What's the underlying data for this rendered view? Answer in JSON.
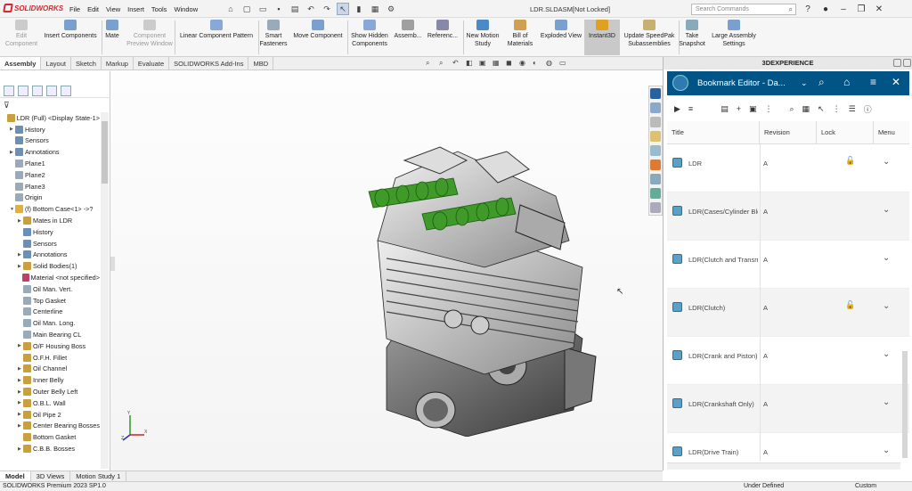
{
  "titlebar": {
    "menus": [
      "File",
      "Edit",
      "View",
      "Insert",
      "Tools",
      "Window"
    ],
    "document_title": "LDR.SLDASM[Not Locked]",
    "search_placeholder": "Search Commands",
    "brand": "SOLIDWORKS"
  },
  "ribbon": [
    {
      "label": "Edit\nComponent",
      "disabled": true
    },
    {
      "label": "Insert Components",
      "disabled": false
    },
    {
      "label": "Mate",
      "disabled": false
    },
    {
      "label": "Component\nPreview Window",
      "disabled": true
    },
    {
      "label": "Linear Component Pattern",
      "disabled": false
    },
    {
      "label": "Smart\nFasteners",
      "disabled": false
    },
    {
      "label": "Move Component",
      "disabled": false
    },
    {
      "label": "Show Hidden\nComponents",
      "disabled": false
    },
    {
      "label": "Assemb...",
      "disabled": false
    },
    {
      "label": "Referenc...",
      "disabled": false
    },
    {
      "label": "New Motion\nStudy",
      "disabled": false
    },
    {
      "label": "Bill of\nMaterials",
      "disabled": false
    },
    {
      "label": "Exploded View",
      "disabled": false
    },
    {
      "label": "Instant3D",
      "disabled": false,
      "active": true
    },
    {
      "label": "Update SpeedPak\nSubassemblies",
      "disabled": false
    },
    {
      "label": "Take\nSnapshot",
      "disabled": false
    },
    {
      "label": "Large Assembly\nSettings",
      "disabled": false
    }
  ],
  "command_tabs": [
    "Assembly",
    "Layout",
    "Sketch",
    "Markup",
    "Evaluate",
    "SOLIDWORKS Add-Ins",
    "MBD"
  ],
  "tree": [
    {
      "label": "LDR (Full) <Display State-1>",
      "indent": 0,
      "expand": "",
      "icon": "#c8a040"
    },
    {
      "label": "History",
      "indent": 1,
      "expand": "▶",
      "icon": "#6b8fb5"
    },
    {
      "label": "Sensors",
      "indent": 1,
      "expand": "",
      "icon": "#6b8fb5"
    },
    {
      "label": "Annotations",
      "indent": 1,
      "expand": "▶",
      "icon": "#6b8fb5"
    },
    {
      "label": "Plane1",
      "indent": 1,
      "expand": "",
      "icon": "#9ab"
    },
    {
      "label": "Plane2",
      "indent": 1,
      "expand": "",
      "icon": "#9ab"
    },
    {
      "label": "Plane3",
      "indent": 1,
      "expand": "",
      "icon": "#9ab"
    },
    {
      "label": "Origin",
      "indent": 1,
      "expand": "",
      "icon": "#9ab"
    },
    {
      "label": "(f) Bottom Case<1> ->?",
      "indent": 1,
      "expand": "▼",
      "icon": "#e0b040"
    },
    {
      "label": "Mates in LDR",
      "indent": 2,
      "expand": "▶",
      "icon": "#c8a040"
    },
    {
      "label": "History",
      "indent": 2,
      "expand": "",
      "icon": "#6b8fb5"
    },
    {
      "label": "Sensors",
      "indent": 2,
      "expand": "",
      "icon": "#6b8fb5"
    },
    {
      "label": "Annotations",
      "indent": 2,
      "expand": "▶",
      "icon": "#6b8fb5"
    },
    {
      "label": "Solid Bodies(1)",
      "indent": 2,
      "expand": "▶",
      "icon": "#c8a040"
    },
    {
      "label": "Material <not specified>",
      "indent": 2,
      "expand": "",
      "icon": "#b46"
    },
    {
      "label": "Oil Man. Vert.",
      "indent": 2,
      "expand": "",
      "icon": "#9ab"
    },
    {
      "label": "Top Gasket",
      "indent": 2,
      "expand": "",
      "icon": "#9ab"
    },
    {
      "label": "Centerline",
      "indent": 2,
      "expand": "",
      "icon": "#9ab"
    },
    {
      "label": "Oil Man. Long.",
      "indent": 2,
      "expand": "",
      "icon": "#9ab"
    },
    {
      "label": "Main Bearing CL",
      "indent": 2,
      "expand": "",
      "icon": "#9ab"
    },
    {
      "label": "O/F Housing Boss",
      "indent": 2,
      "expand": "▶",
      "icon": "#c8a040"
    },
    {
      "label": "O.F.H. Fillet",
      "indent": 2,
      "expand": "",
      "icon": "#c8a040"
    },
    {
      "label": "Oil Channel",
      "indent": 2,
      "expand": "▶",
      "icon": "#c8a040"
    },
    {
      "label": "Inner Belly",
      "indent": 2,
      "expand": "▶",
      "icon": "#c8a040"
    },
    {
      "label": "Outer Belly Left",
      "indent": 2,
      "expand": "▶",
      "icon": "#c8a040"
    },
    {
      "label": "O.B.L. Wall",
      "indent": 2,
      "expand": "▶",
      "icon": "#c8a040"
    },
    {
      "label": "Oil Pipe 2",
      "indent": 2,
      "expand": "▶",
      "icon": "#c8a040"
    },
    {
      "label": "Center Bearing Bosses",
      "indent": 2,
      "expand": "▶",
      "icon": "#c8a040"
    },
    {
      "label": "Bottom Gasket",
      "indent": 2,
      "expand": "",
      "icon": "#c8a040"
    },
    {
      "label": "C.B.B. Bosses",
      "indent": 2,
      "expand": "▶",
      "icon": "#c8a040"
    }
  ],
  "x3d_panel": {
    "header": "3DEXPERIENCE",
    "bookmark_title": "Bookmark Editor - Da...",
    "columns": [
      "Title",
      "Revision",
      "Lock",
      "Menu"
    ],
    "rows": [
      {
        "title": "LDR",
        "revision": "A",
        "locked": true
      },
      {
        "title": "LDR(Cases/Cylinder Block)",
        "revision": "A",
        "locked": false
      },
      {
        "title": "LDR(Clutch and Transmission)",
        "revision": "A",
        "locked": false
      },
      {
        "title": "LDR(Clutch)",
        "revision": "A",
        "locked": true
      },
      {
        "title": "LDR(Crank and Piston)",
        "revision": "A",
        "locked": false
      },
      {
        "title": "LDR(Crankshaft Only)",
        "revision": "A",
        "locked": false
      },
      {
        "title": "LDR(Drive Train)",
        "revision": "A",
        "locked": false
      }
    ]
  },
  "bottom_tabs": [
    "Model",
    "3D Views",
    "Motion Study 1"
  ],
  "status": {
    "product": "SOLIDWORKS Premium 2023 SP1.0",
    "state": "Under Defined",
    "units": "Custom"
  },
  "colors": {
    "accent_blue": "#005486",
    "active_tab": "#c9c9c9",
    "cam_green": "#3f9a2a",
    "lock_green": "#3aa63a"
  }
}
